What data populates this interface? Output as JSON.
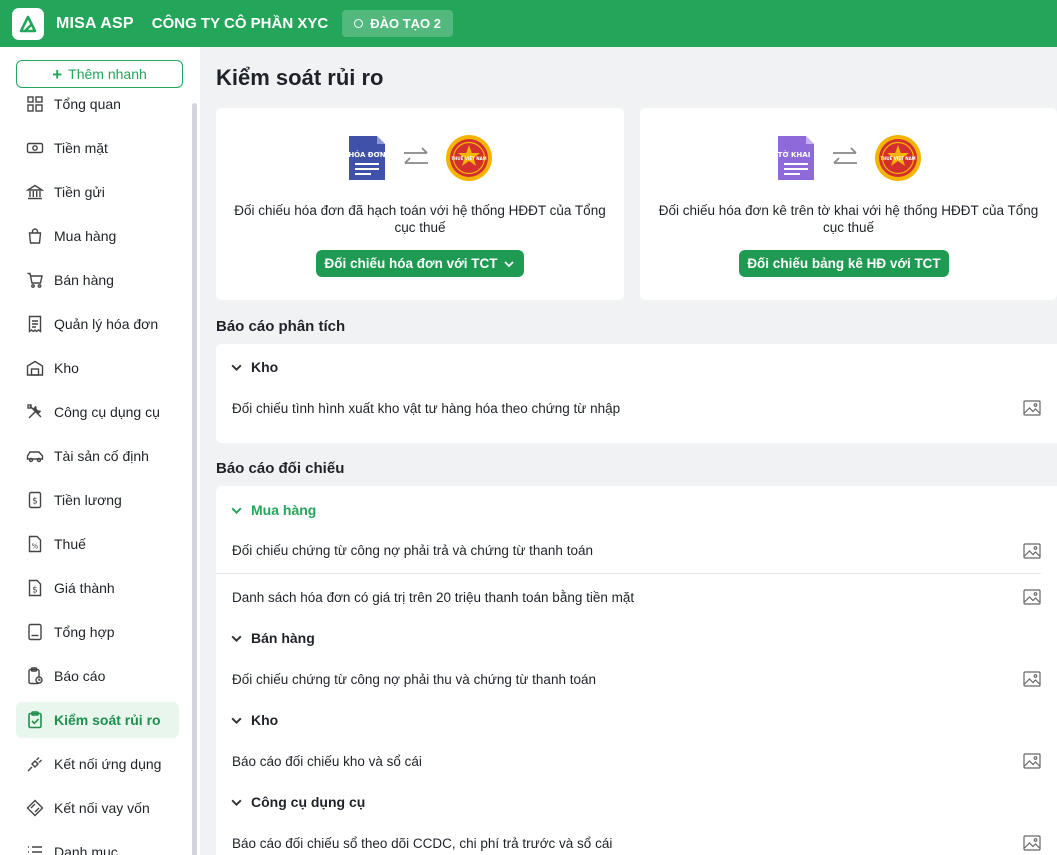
{
  "topbar": {
    "app_name": "MISA ASP",
    "company": "CÔNG TY CÔ PHẦN XYC",
    "database": "ĐÀO TẠO 2",
    "brand_color": "#23a55a"
  },
  "sidebar": {
    "quick_add": "Thêm nhanh",
    "items": [
      {
        "label": "Tổng quan",
        "icon": "dashboard-icon"
      },
      {
        "label": "Tiền mặt",
        "icon": "cash-icon"
      },
      {
        "label": "Tiền gửi",
        "icon": "bank-icon"
      },
      {
        "label": "Mua hàng",
        "icon": "shopping-bag-icon"
      },
      {
        "label": "Bán hàng",
        "icon": "cart-icon"
      },
      {
        "label": "Quản lý hóa đơn",
        "icon": "invoice-icon"
      },
      {
        "label": "Kho",
        "icon": "warehouse-icon"
      },
      {
        "label": "Công cụ dụng cụ",
        "icon": "tools-icon"
      },
      {
        "label": "Tài sản cố định",
        "icon": "car-icon"
      },
      {
        "label": "Tiền lương",
        "icon": "salary-icon"
      },
      {
        "label": "Thuế",
        "icon": "tax-icon"
      },
      {
        "label": "Giá thành",
        "icon": "cost-icon"
      },
      {
        "label": "Tổng hợp",
        "icon": "ledger-icon"
      },
      {
        "label": "Báo cáo",
        "icon": "report-icon"
      },
      {
        "label": "Kiểm soát rủi ro",
        "icon": "risk-check-icon",
        "active": true
      },
      {
        "label": "Kết nối ứng dụng",
        "icon": "plug-icon"
      },
      {
        "label": "Kết nối vay vốn",
        "icon": "loan-icon"
      },
      {
        "label": "Danh mục",
        "icon": "list-icon"
      }
    ]
  },
  "main": {
    "title": "Kiểm soát rủi ro",
    "cards": [
      {
        "doc_label": "HÓA ĐƠN",
        "seal_label": "THUẾ VIỆT NAM",
        "description": "Đối chiếu hóa đơn đã hạch toán với hệ thống HĐĐT của Tổng cục thuế",
        "button": "Đối chiếu hóa đơn với TCT"
      },
      {
        "doc_label": "TỜ KHAI",
        "seal_label": "THUẾ VIỆT NAM",
        "description": "Đối chiếu hóa đơn kê trên tờ khai với hệ thống HĐĐT của Tổng cục thuế",
        "button": "Đối chiếu bảng kê HĐ với TCT"
      }
    ],
    "analysis": {
      "title": "Báo cáo phân tích",
      "groups": [
        {
          "name": "Kho",
          "rows": [
            "Đối chiếu tình hình xuất kho vật tư hàng hóa theo chứng từ nhập"
          ]
        }
      ]
    },
    "reconcile": {
      "title": "Báo cáo đối chiếu",
      "groups": [
        {
          "name": "Mua hàng",
          "rows": [
            "Đối chiếu chứng từ công nợ phải trả và chứng từ thanh toán",
            "Danh sách hóa đơn có giá trị trên 20 triệu thanh toán bằng tiền mặt"
          ]
        },
        {
          "name": "Bán hàng",
          "rows": [
            "Đối chiếu chứng từ công nợ phải thu và chứng từ thanh toán"
          ]
        },
        {
          "name": "Kho",
          "rows": [
            "Báo cáo đối chiếu kho và sổ cái"
          ]
        },
        {
          "name": "Công cụ dụng cụ",
          "rows": [
            "Báo cáo đối chiếu sổ theo dõi CCDC, chi phí trả trước và sổ cái"
          ]
        }
      ]
    }
  }
}
